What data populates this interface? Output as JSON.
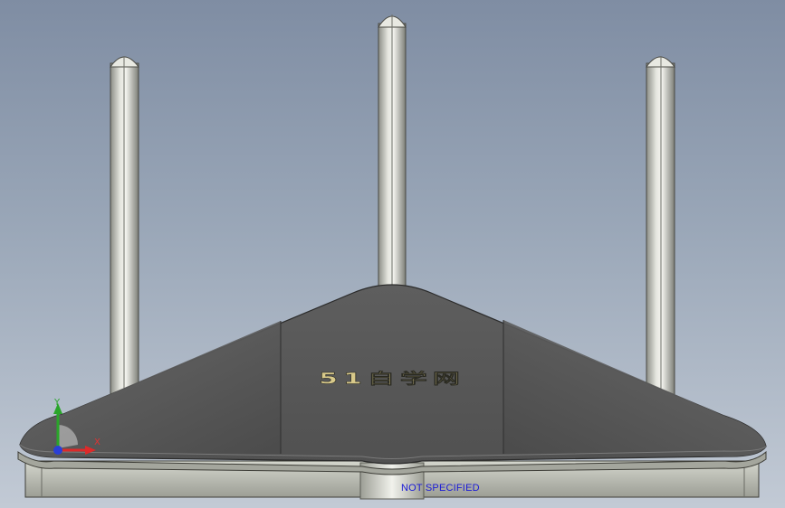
{
  "viewport": {
    "material_label": "NOT SPECIFIED",
    "material_label_color": "#1a1ad6",
    "background_top": "#7f8da3",
    "background_bottom": "#c2cad5"
  },
  "model": {
    "antenna_count": 3,
    "engraved_text": "51自学网",
    "body_color": "#5a5a5a",
    "base_color": "#b9bbb0",
    "antenna_color": "#c9cbc3",
    "engraving_color": "#d8c98a"
  },
  "triad": {
    "x_label": "X",
    "y_label": "Y",
    "x_color": "#dd2a2a",
    "y_color": "#2aa52a",
    "origin_color": "#2a3fd6"
  }
}
